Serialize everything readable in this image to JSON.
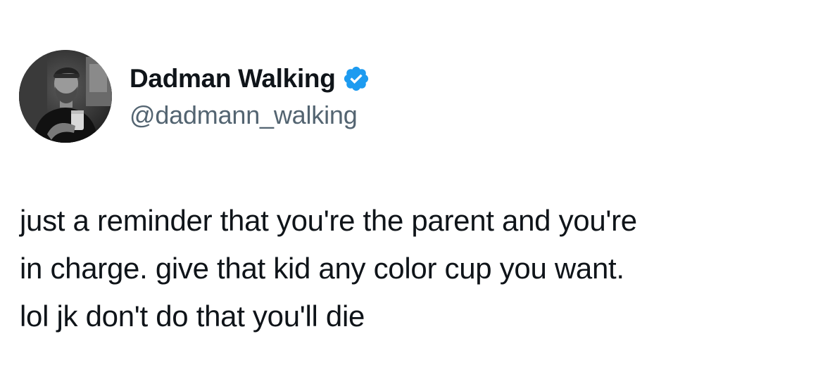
{
  "author": {
    "display_name": "Dadman Walking",
    "handle": "@dadmann_walking",
    "verified": true,
    "verified_icon": "verified-badge-icon",
    "verified_color": "#1d9bf0"
  },
  "tweet": {
    "lines": [
      "just a reminder that you're the parent and you're",
      "in charge. give that kid any color cup you want.",
      "lol jk don't do that you'll die"
    ]
  },
  "colors": {
    "text": "#0f1419",
    "handle": "#536471",
    "background": "#ffffff"
  }
}
